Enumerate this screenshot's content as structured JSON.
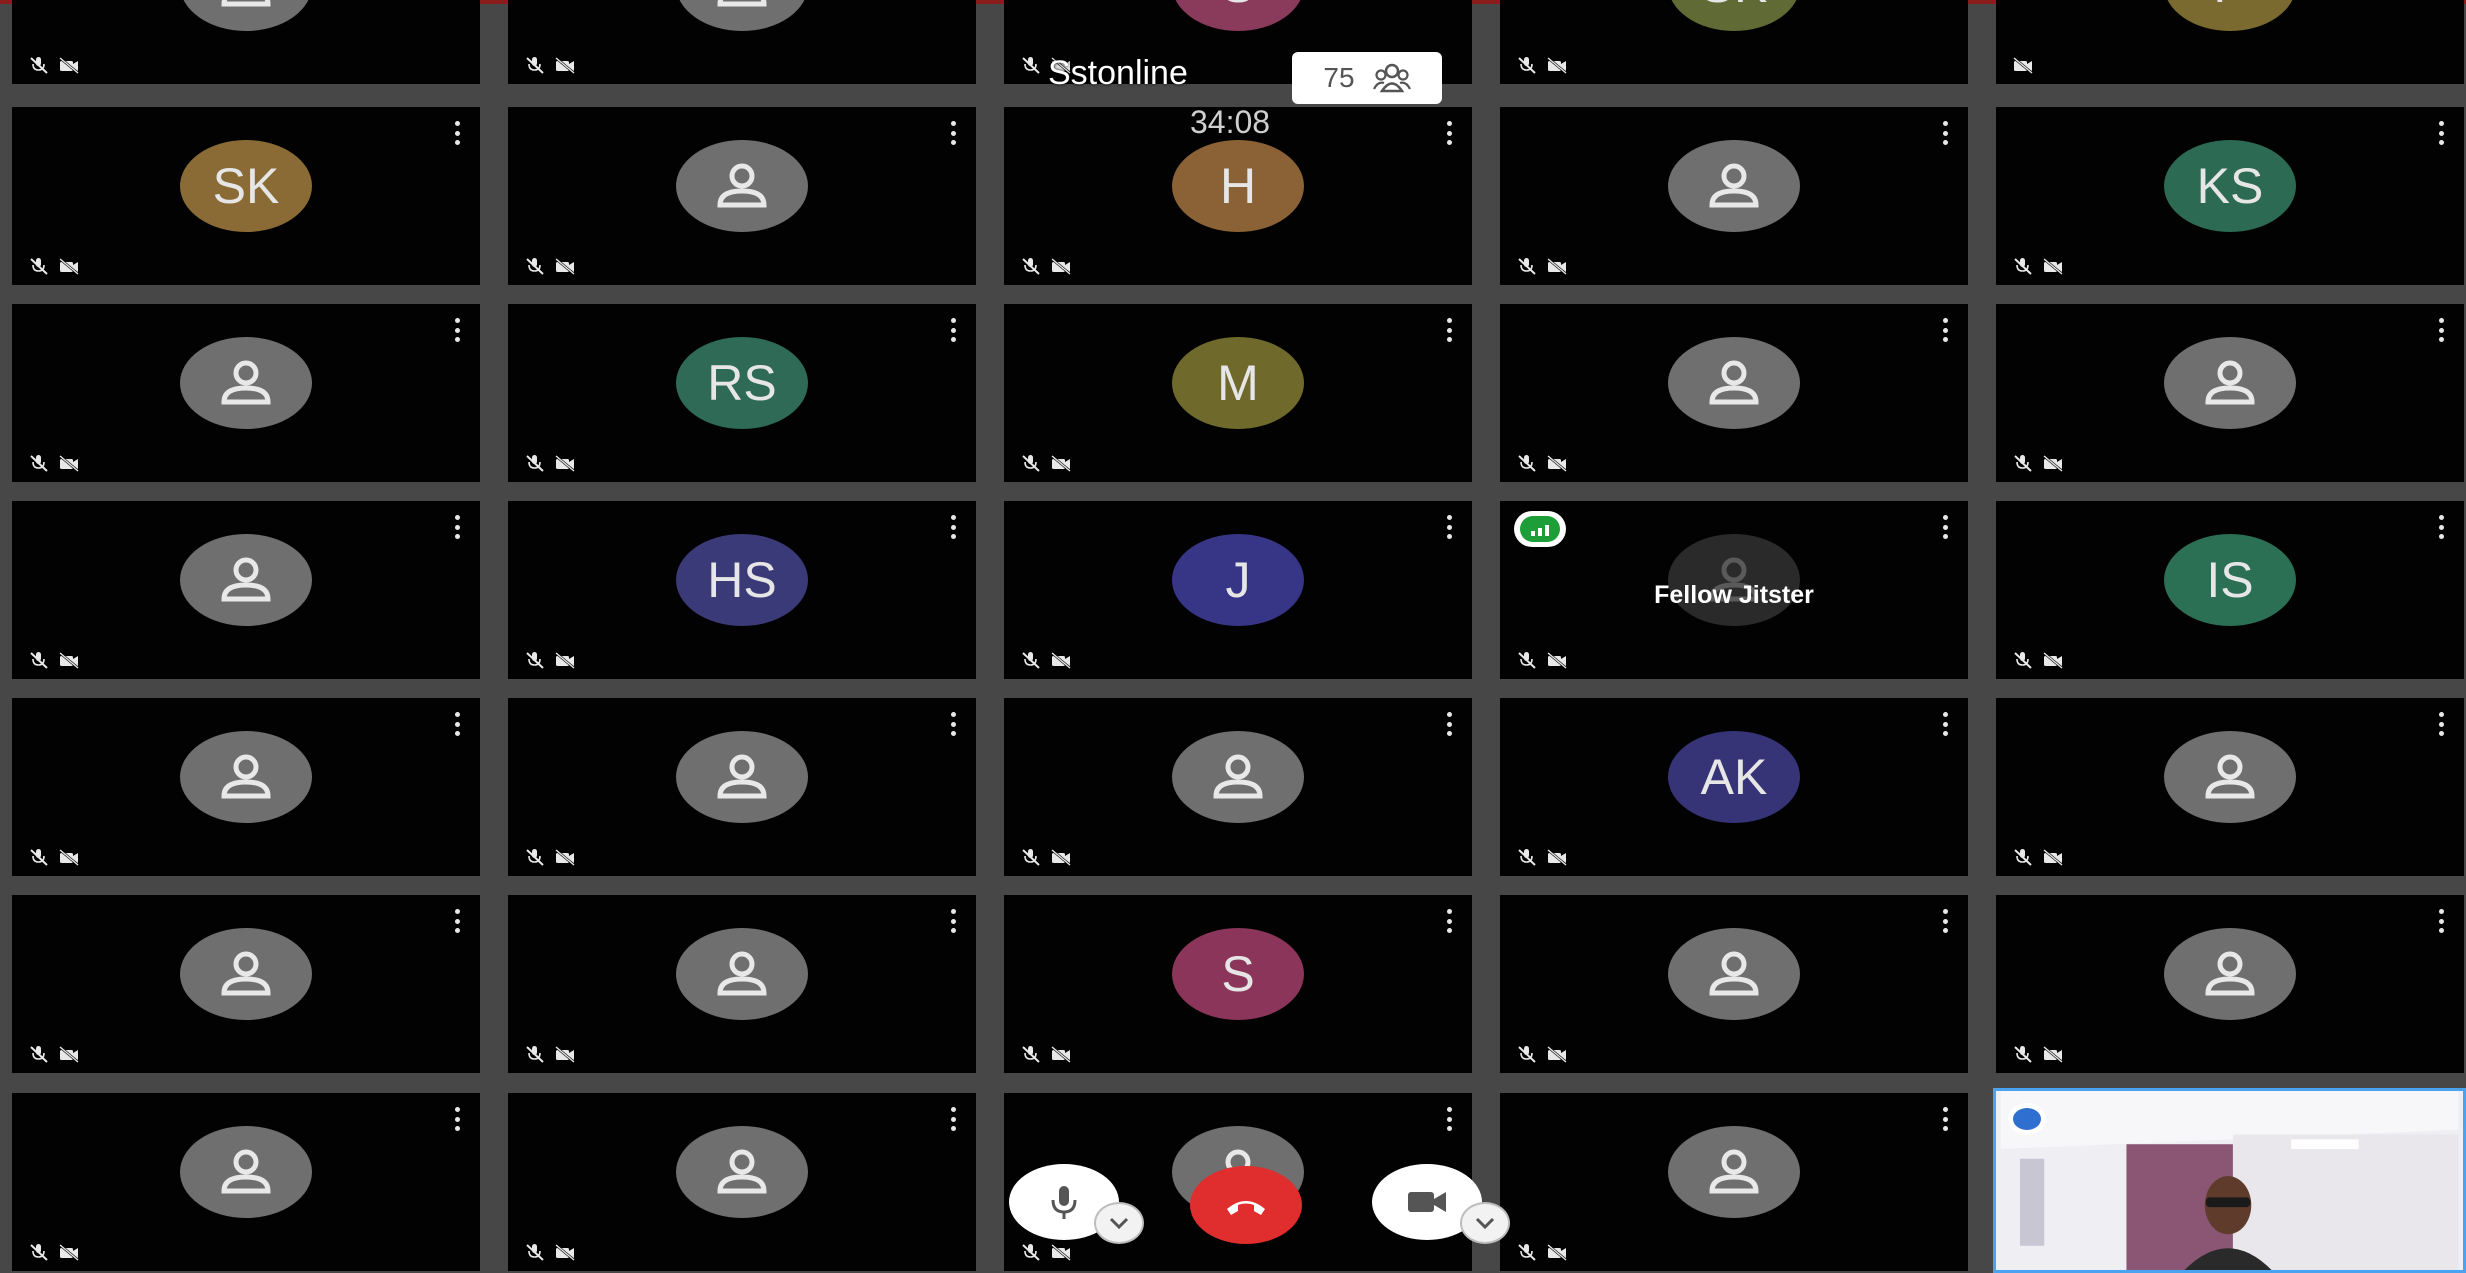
{
  "meeting": {
    "name": "Sstonline",
    "participant_count": "75",
    "timer": "34:08"
  },
  "featured_tile": {
    "name": "Fellow Jitster"
  },
  "rows": [
    [
      "",
      "",
      "S",
      "SK",
      "P"
    ],
    [
      "SK",
      "",
      "H",
      "",
      "KS"
    ],
    [
      "",
      "RS",
      "M",
      "",
      ""
    ],
    [
      "",
      "HS",
      "J",
      "",
      "IS"
    ],
    [
      "",
      "",
      "",
      "AK",
      ""
    ],
    [
      "",
      "",
      "S",
      "",
      ""
    ],
    [
      "",
      "",
      "",
      "",
      ""
    ]
  ],
  "colors": {
    "SK": "#8a6b35",
    "P": "#7a6a30",
    "S_top": "#8a3a5a",
    "SK_top": "#5f6a34",
    "H": "#8a6235",
    "KS": "#2c6a54",
    "RS": "#2e6a55",
    "M": "#6f6a2c",
    "HS": "#3a3a78",
    "J": "#373585",
    "IS": "#2b6f55",
    "AK": "#363477",
    "S": "#8a3559",
    "generic": "#6f6f6f",
    "hangup": "#e02d2d",
    "connection": "#1e9e39"
  },
  "icons": {
    "mic_off": "mic-off-icon",
    "cam_off": "camera-off-icon",
    "menu": "more-vertical-icon",
    "participants": "participants-icon",
    "mic": "microphone-icon",
    "hangup": "hangup-icon",
    "camera": "camera-icon",
    "chevron": "chevron-down-icon",
    "person": "person-icon",
    "connection": "connection-quality-icon"
  }
}
